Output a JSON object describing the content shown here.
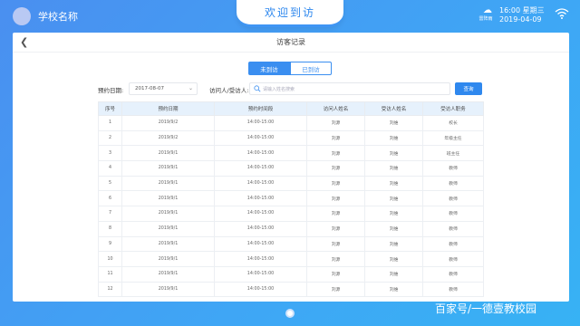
{
  "app": {
    "school_name": "学校名称",
    "title": "欢迎到访"
  },
  "status": {
    "weather_icon": "cloud-rain-icon",
    "weather_label": "雷阵雨",
    "time": "16:00",
    "weekday": "星期三",
    "date": "2019-04-09",
    "wifi_icon": "wifi-icon"
  },
  "page": {
    "back_icon": "chevron-left-icon",
    "title": "访客记录"
  },
  "tabs": [
    {
      "label": "未到访",
      "active": true
    },
    {
      "label": "已到访",
      "active": false
    }
  ],
  "filters": {
    "date_label": "预约日期:",
    "date_value": "2017-08-07",
    "visitor_label": "访问人/受访人:",
    "search_placeholder": "请输入姓名搜索",
    "query_button": "查询"
  },
  "table": {
    "headers": [
      "序号",
      "预约日期",
      "预约时间段",
      "访问人姓名",
      "受访人姓名",
      "受访人职务"
    ],
    "rows": [
      [
        "1",
        "2019/9/2",
        "14:00-15:00",
        "刘源",
        "刘维",
        "校长"
      ],
      [
        "2",
        "2019/9/2",
        "14:00-15:00",
        "刘源",
        "刘维",
        "年级主任"
      ],
      [
        "3",
        "2019/9/1",
        "14:00-15:00",
        "刘源",
        "刘维",
        "班主任"
      ],
      [
        "4",
        "2019/9/1",
        "14:00-15:00",
        "刘源",
        "刘维",
        "教师"
      ],
      [
        "5",
        "2019/9/1",
        "14:00-15:00",
        "刘源",
        "刘维",
        "教师"
      ],
      [
        "6",
        "2019/9/1",
        "14:00-15:00",
        "刘源",
        "刘维",
        "教师"
      ],
      [
        "7",
        "2019/9/1",
        "14:00-15:00",
        "刘源",
        "刘维",
        "教师"
      ],
      [
        "8",
        "2019/9/1",
        "14:00-15:00",
        "刘源",
        "刘维",
        "教师"
      ],
      [
        "9",
        "2019/9/1",
        "14:00-15:00",
        "刘源",
        "刘维",
        "教师"
      ],
      [
        "10",
        "2019/9/1",
        "14:00-15:00",
        "刘源",
        "刘维",
        "教师"
      ],
      [
        "11",
        "2019/9/1",
        "14:00-15:00",
        "刘源",
        "刘维",
        "教师"
      ],
      [
        "12",
        "2019/9/1",
        "14:00-15:00",
        "刘源",
        "刘维",
        "教师"
      ]
    ]
  },
  "watermark": "百家号/一德壹教校园",
  "colors": {
    "accent": "#2f88ee",
    "header_row": "#e6f1fc",
    "background": "#3fa6f5"
  }
}
